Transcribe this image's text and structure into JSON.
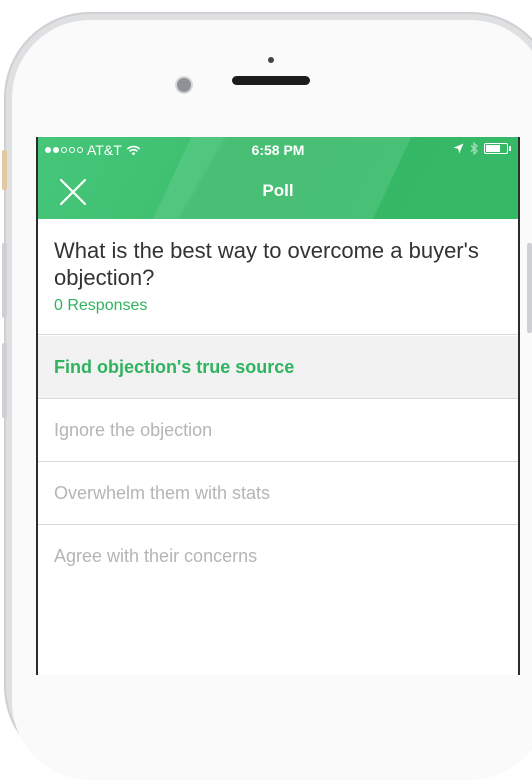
{
  "status_bar": {
    "carrier": "AT&T",
    "time": "6:58 PM"
  },
  "nav": {
    "title": "Poll",
    "close_icon": "close-icon"
  },
  "poll": {
    "question": "What is the best way to overcome a buyer's objection?",
    "responses_label": "0 Responses",
    "options": [
      {
        "label": "Find objection's true source",
        "selected": true
      },
      {
        "label": "Ignore the objection",
        "selected": false
      },
      {
        "label": "Overwhelm them with stats",
        "selected": false
      },
      {
        "label": "Agree with their concerns",
        "selected": false
      }
    ]
  },
  "colors": {
    "accent": "#35b967",
    "accent_text": "#2fb35f",
    "muted_text": "#b5b5b5"
  }
}
